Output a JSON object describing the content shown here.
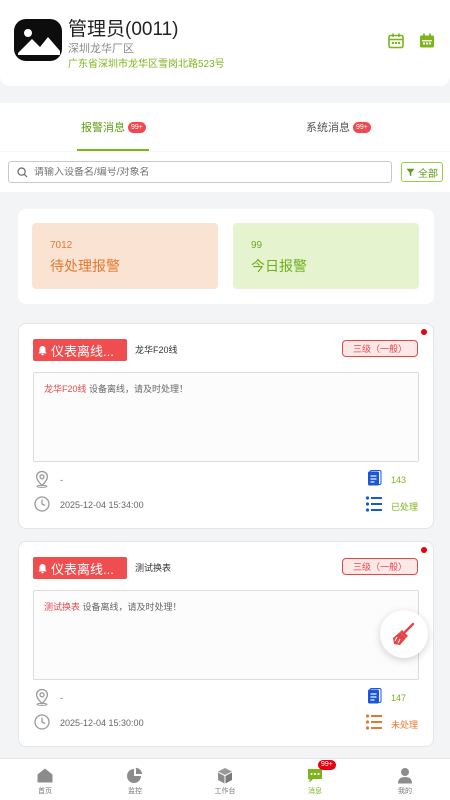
{
  "header": {
    "name": "管理员(0011)",
    "company": "深圳龙华厂区",
    "address": "广东省深圳市龙华区雪岗北路523号"
  },
  "tabs": [
    {
      "label": "报警消息",
      "badge": "99+"
    },
    {
      "label": "系统消息",
      "badge": "99+"
    }
  ],
  "search": {
    "placeholder": "请输入设备名/编号/对象名",
    "filter_label": "全部"
  },
  "stats": {
    "pending": {
      "count": "7012",
      "label": "待处理报警"
    },
    "today": {
      "count": "99",
      "label": "今日报警"
    }
  },
  "alarms": [
    {
      "tag": "仪表离线...",
      "device": "龙华F20线",
      "level": "三级（一般）",
      "msg_highlight": "龙华F20线",
      "msg_rest": " 设备离线，请及时处理！",
      "location": "-",
      "time": "2025-12-04 15:34:00",
      "number": "143",
      "status": "已处理"
    },
    {
      "tag": "仪表离线...",
      "device": "测试换表",
      "level": "三级（一般）",
      "msg_highlight": "测试换表",
      "msg_rest": " 设备离线，请及时处理！",
      "location": "-",
      "time": "2025-12-04 15:30:00",
      "number": "147",
      "status": "未处理"
    }
  ],
  "nav": [
    {
      "label": "首页"
    },
    {
      "label": "监控"
    },
    {
      "label": "工作台"
    },
    {
      "label": "消息",
      "badge": "99+"
    },
    {
      "label": "我的"
    }
  ],
  "colors": {
    "accent": "#7cb518",
    "alarm_red": "#f04d4f",
    "processed": "#7cb518",
    "unprocessed": "#e2792f"
  },
  "icons": {
    "calendar": "calendar-icon",
    "calendar_filled": "calendar-filled-icon",
    "search": "search-icon",
    "filter": "filter-icon",
    "bell": "bell-icon",
    "location": "location-pin-icon",
    "clock": "clock-icon",
    "document": "document-icon",
    "list": "list-icon",
    "broom": "broom-icon",
    "home": "home-icon",
    "monitor": "pie-chart-icon",
    "workbench": "cube-icon",
    "message": "chat-icon",
    "profile": "user-icon"
  }
}
